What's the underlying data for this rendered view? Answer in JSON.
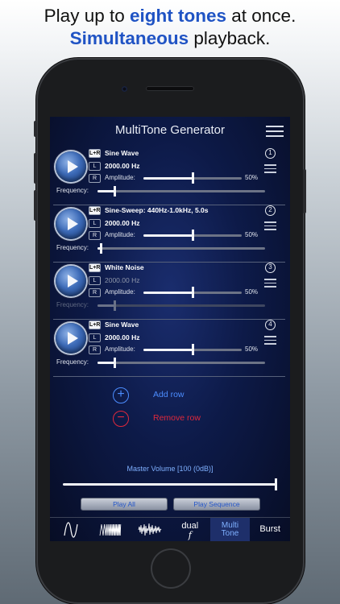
{
  "headline": {
    "line1_pre": "Play up to ",
    "line1_highlight": "eight tones",
    "line1_post": " at once.",
    "line2_highlight": "Simultaneous",
    "line2_post": " playback."
  },
  "app": {
    "title": "MultiTone Generator",
    "menu_icon": "hamburger-menu-icon"
  },
  "rows": [
    {
      "number": "1",
      "wave": "Sine Wave",
      "frequency": "2000.00 Hz",
      "frequency_enabled": true,
      "amplitude_label": "Amplitude:",
      "amplitude_pct": "50%",
      "amplitude_value": 0.5,
      "frequency_label": "Frequency:",
      "frequency_slider": 0.1,
      "channels": [
        "L+R",
        "L",
        "R"
      ]
    },
    {
      "number": "2",
      "wave": "Sine-Sweep: 440Hz-1.0kHz, 5.0s",
      "frequency": "2000.00 Hz",
      "frequency_enabled": true,
      "amplitude_label": "Amplitude:",
      "amplitude_pct": "50%",
      "amplitude_value": 0.5,
      "frequency_label": "Frequency:",
      "frequency_slider": 0.02,
      "channels": [
        "L+R",
        "L",
        "R"
      ]
    },
    {
      "number": "3",
      "wave": "White Noise",
      "frequency": "2000.00 Hz",
      "frequency_enabled": false,
      "amplitude_label": "Amplitude:",
      "amplitude_pct": "50%",
      "amplitude_value": 0.5,
      "frequency_label": "Frequency:",
      "frequency_slider": 0.1,
      "channels": [
        "L+R",
        "L",
        "R"
      ]
    },
    {
      "number": "4",
      "wave": "Sine Wave",
      "frequency": "2000.00 Hz",
      "frequency_enabled": true,
      "amplitude_label": "Amplitude:",
      "amplitude_pct": "50%",
      "amplitude_value": 0.5,
      "frequency_label": "Frequency:",
      "frequency_slider": 0.1,
      "channels": [
        "L+R",
        "L",
        "R"
      ]
    }
  ],
  "actions": {
    "add_row": "Add row",
    "remove_row": "Remove row"
  },
  "master": {
    "label": "Master Volume [100 (0dB)]",
    "value": 1.0
  },
  "buttons": {
    "play_all": "Play All",
    "play_sequence": "Play Sequence"
  },
  "tabs": [
    {
      "icon": "sine-wave-icon",
      "label": "",
      "active": false
    },
    {
      "icon": "sweep-wave-icon",
      "label": "",
      "active": false
    },
    {
      "icon": "noise-wave-icon",
      "label": "",
      "active": false
    },
    {
      "icon": "dual-frequency-icon",
      "label": "dual",
      "label2": "f",
      "active": false
    },
    {
      "icon": "",
      "label": "Multi",
      "label2": "Tone",
      "active": true
    },
    {
      "icon": "",
      "label": "Burst",
      "label2": "",
      "active": false
    }
  ],
  "colors": {
    "headline_accent": "#1f53c4",
    "add_accent": "#4c8dff",
    "remove_accent": "#e0283c",
    "screen_bg": "#0d1a48"
  }
}
